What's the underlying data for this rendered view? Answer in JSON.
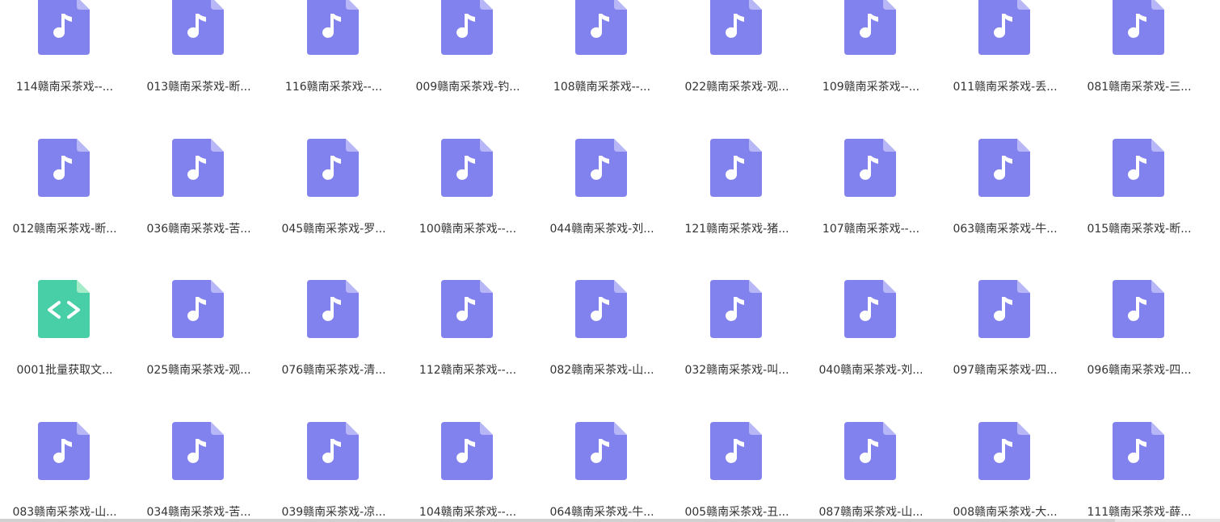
{
  "colors": {
    "audio_icon": "#8282ef",
    "audio_icon_fold": "#b7b7f8",
    "code_icon": "#48cfa8",
    "code_icon_fold": "#a6ecc8",
    "label_text": "#333333"
  },
  "files": [
    {
      "label": "114赣南采茶戏--...",
      "icon": "audio-file-icon"
    },
    {
      "label": "013赣南采茶戏-断...",
      "icon": "audio-file-icon"
    },
    {
      "label": "116赣南采茶戏--...",
      "icon": "audio-file-icon"
    },
    {
      "label": "009赣南采茶戏-钓...",
      "icon": "audio-file-icon"
    },
    {
      "label": "108赣南采茶戏--...",
      "icon": "audio-file-icon"
    },
    {
      "label": "022赣南采茶戏-观...",
      "icon": "audio-file-icon"
    },
    {
      "label": "109赣南采茶戏--...",
      "icon": "audio-file-icon"
    },
    {
      "label": "011赣南采茶戏-丢...",
      "icon": "audio-file-icon"
    },
    {
      "label": "081赣南采茶戏-三...",
      "icon": "audio-file-icon"
    },
    {
      "label": "012赣南采茶戏-断...",
      "icon": "audio-file-icon"
    },
    {
      "label": "036赣南采茶戏-苦...",
      "icon": "audio-file-icon"
    },
    {
      "label": "045赣南采茶戏-罗...",
      "icon": "audio-file-icon"
    },
    {
      "label": "100赣南采茶戏--...",
      "icon": "audio-file-icon"
    },
    {
      "label": "044赣南采茶戏-刘...",
      "icon": "audio-file-icon"
    },
    {
      "label": "121赣南采茶戏-猪...",
      "icon": "audio-file-icon"
    },
    {
      "label": "107赣南采茶戏--...",
      "icon": "audio-file-icon"
    },
    {
      "label": "063赣南采茶戏-牛...",
      "icon": "audio-file-icon"
    },
    {
      "label": "015赣南采茶戏-断...",
      "icon": "audio-file-icon"
    },
    {
      "label": "0001批量获取文...",
      "icon": "code-file-icon"
    },
    {
      "label": "025赣南采茶戏-观...",
      "icon": "audio-file-icon"
    },
    {
      "label": "076赣南采茶戏-清...",
      "icon": "audio-file-icon"
    },
    {
      "label": "112赣南采茶戏--...",
      "icon": "audio-file-icon"
    },
    {
      "label": "082赣南采茶戏-山...",
      "icon": "audio-file-icon"
    },
    {
      "label": "032赣南采茶戏-叫...",
      "icon": "audio-file-icon"
    },
    {
      "label": "040赣南采茶戏-刘...",
      "icon": "audio-file-icon"
    },
    {
      "label": "097赣南采茶戏-四...",
      "icon": "audio-file-icon"
    },
    {
      "label": "096赣南采茶戏-四...",
      "icon": "audio-file-icon"
    },
    {
      "label": "083赣南采茶戏-山...",
      "icon": "audio-file-icon"
    },
    {
      "label": "034赣南采茶戏-苦...",
      "icon": "audio-file-icon"
    },
    {
      "label": "039赣南采茶戏-凉...",
      "icon": "audio-file-icon"
    },
    {
      "label": "104赣南采茶戏--...",
      "icon": "audio-file-icon"
    },
    {
      "label": "064赣南采茶戏-牛...",
      "icon": "audio-file-icon"
    },
    {
      "label": "005赣南采茶戏-丑...",
      "icon": "audio-file-icon"
    },
    {
      "label": "087赣南采茶戏-山...",
      "icon": "audio-file-icon"
    },
    {
      "label": "008赣南采茶戏-大...",
      "icon": "audio-file-icon"
    },
    {
      "label": "111赣南采茶戏-薛...",
      "icon": "audio-file-icon"
    }
  ]
}
